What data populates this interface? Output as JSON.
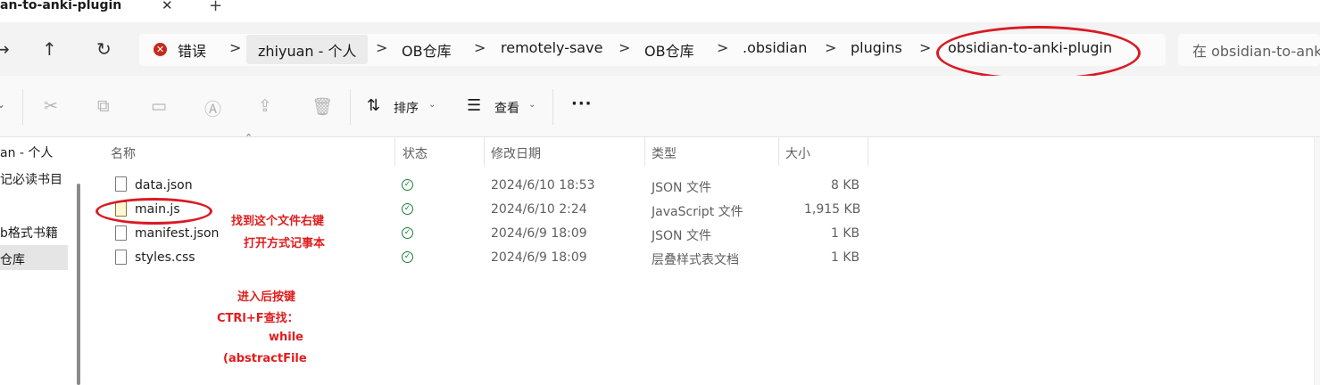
{
  "tab": {
    "title": "an-to-anki-plugin",
    "close": "✕",
    "new_tab": "+"
  },
  "nav": {
    "back": "→",
    "up": "↑",
    "refresh": "↻"
  },
  "address": {
    "error_label": "错误",
    "crumbs": [
      "zhiyuan - 个人",
      "OB仓库",
      "remotely-save",
      "OB仓库",
      ".obsidian",
      "plugins",
      "obsidian-to-anki-plugin"
    ],
    "separator": ">"
  },
  "search": {
    "placeholder": "在 obsidian-to-ank"
  },
  "toolbar": {
    "sort_label": "排序",
    "view_label": "查看",
    "more_label": "···"
  },
  "sidebar": {
    "items": [
      "an - 个人",
      "记必读书目",
      "b格式书籍",
      "仓库"
    ],
    "fragments": [
      "",
      "",
      "",
      "",
      ""
    ]
  },
  "columns": {
    "name": "名称",
    "status": "状态",
    "modified": "修改日期",
    "type": "类型",
    "size": "大小"
  },
  "files": [
    {
      "name": "data.json",
      "modified": "2024/6/10 18:53",
      "type": "JSON 文件",
      "size": "8 KB"
    },
    {
      "name": "main.js",
      "modified": "2024/6/10 2:24",
      "type": "JavaScript 文件",
      "size": "1,915 KB"
    },
    {
      "name": "manifest.json",
      "modified": "2024/6/9 18:09",
      "type": "JSON 文件",
      "size": "1 KB"
    },
    {
      "name": "styles.css",
      "modified": "2024/6/9 18:09",
      "type": "层叠样式表文档",
      "size": "1 KB"
    }
  ],
  "annotations": {
    "a1": "找到这个文件右键",
    "a2": "打开方式记事本",
    "b1": "进入后按键",
    "b2": "CTRl+F查找：",
    "b3": "while",
    "b4": "(abstractFile"
  },
  "colors": {
    "annotation": "#e11d1d",
    "status_ok": "#1a7f37",
    "error": "#c42b1c"
  }
}
